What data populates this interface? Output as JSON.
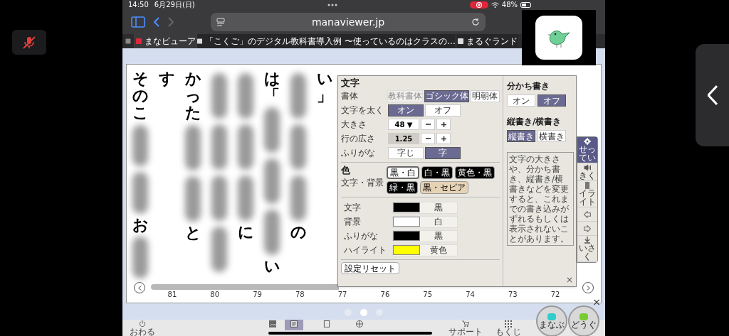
{
  "status_bar": {
    "time": "14:50",
    "date": "6月29日(日)",
    "battery": "48%",
    "recording": true
  },
  "browser": {
    "url": "manaviewer.jp",
    "tabs": [
      {
        "label": "まなビューア",
        "selected": true
      },
      {
        "label": "「こくご」のデジタル教科書導入例 〜使っているのはクラスの…",
        "selected": false
      },
      {
        "label": "まるぐランド",
        "selected": false
      }
    ]
  },
  "page": {
    "columns": [
      {
        "segments": [
          {
            "kind": "text",
            "text": "そのこ"
          },
          {
            "kind": "blur"
          },
          {
            "kind": "blur"
          },
          {
            "kind": "text",
            "text": "お"
          },
          {
            "kind": "blur"
          }
        ]
      },
      {
        "segments": [
          {
            "kind": "text",
            "text": "す"
          }
        ]
      },
      {
        "segments": [
          {
            "kind": "text",
            "text": "かった"
          },
          {
            "kind": "blur"
          },
          {
            "kind": "blur"
          },
          {
            "kind": "text",
            "text": "と"
          }
        ]
      },
      {
        "segments": [
          {
            "kind": "blur"
          },
          {
            "kind": "blur"
          },
          {
            "kind": "blur"
          },
          {
            "kind": "blur"
          }
        ]
      },
      {
        "segments": [
          {
            "kind": "blur"
          },
          {
            "kind": "blur"
          },
          {
            "kind": "blur"
          },
          {
            "kind": "text",
            "text": "に"
          }
        ]
      },
      {
        "segments": [
          {
            "kind": "text",
            "text": "は「"
          },
          {
            "kind": "blur"
          },
          {
            "kind": "blur"
          },
          {
            "kind": "blur"
          },
          {
            "kind": "text",
            "text": "い"
          }
        ]
      },
      {
        "segments": [
          {
            "kind": "blur"
          },
          {
            "kind": "blur"
          },
          {
            "kind": "blur"
          },
          {
            "kind": "text",
            "text": "の"
          }
        ]
      },
      {
        "segments": [
          {
            "kind": "text",
            "text": "い」"
          }
        ]
      }
    ],
    "page_numbers": [
      "81",
      "80",
      "79",
      "78",
      "77",
      "76",
      "75",
      "74",
      "73",
      "72"
    ],
    "dots": [
      {
        "selected": false
      },
      {
        "selected": true
      },
      {
        "selected": false
      }
    ]
  },
  "settings": {
    "moji": {
      "title": "文字",
      "rows": [
        {
          "label": "書体",
          "kind": "options",
          "options": [
            {
              "label": "教科書体",
              "selected": false,
              "disabled": true
            },
            {
              "label": "ゴシック体",
              "selected": true,
              "disabled": false
            },
            {
              "label": "明朝体",
              "selected": false,
              "disabled": false
            }
          ]
        },
        {
          "label": "文字を太く",
          "kind": "options",
          "options": [
            {
              "label": "オン",
              "selected": true,
              "disabled": false
            },
            {
              "label": "オフ",
              "selected": false,
              "disabled": false
            }
          ]
        },
        {
          "label": "大きさ",
          "kind": "dropdown",
          "value": "48 ▼"
        },
        {
          "label": "行の広さ",
          "kind": "stepper",
          "value": "1.25"
        },
        {
          "label": "ふりがな",
          "kind": "options",
          "options": [
            {
              "label": "字じ",
              "selected": false,
              "disabled": false
            },
            {
              "label": "字",
              "selected": true,
              "disabled": false
            }
          ]
        }
      ]
    },
    "iro": {
      "title": "色",
      "label": "文字・背景",
      "presets": [
        {
          "label": "黒・白",
          "color": "#ffffff",
          "selected": true
        },
        {
          "label": "白・黒",
          "color": "#000000",
          "selected": false
        },
        {
          "label": "黄色・黒",
          "color": "#000000",
          "selected": false
        },
        {
          "label": "緑・黒",
          "color": "#000000",
          "selected": false
        },
        {
          "label": "黒・セピア",
          "color": "#e6d3b5",
          "selected": false
        }
      ],
      "swatches": [
        {
          "label": "文字",
          "color": "#000000",
          "name": "黒"
        },
        {
          "label": "背景",
          "color": "#ffffff",
          "name": "白"
        },
        {
          "label": "ふりがな",
          "color": "#000000",
          "name": "黒"
        },
        {
          "label": "ハイライト",
          "color": "#ffff00",
          "name": "黄色"
        }
      ]
    },
    "reset": "設定リセット",
    "close": "×",
    "wakachi": {
      "title": "分かち書き",
      "options": [
        {
          "label": "オン",
          "selected": false
        },
        {
          "label": "オフ",
          "selected": true
        }
      ]
    },
    "direction": {
      "title": "縦書き/横書き",
      "options": [
        {
          "label": "縦書き",
          "selected": true
        },
        {
          "label": "横書き",
          "selected": false
        }
      ]
    },
    "note": "文字の大きさや、分かち書き、縦書き/横書きなどを変更すると、これまでの書き込みがずれるもしくは表示されないことがあります。"
  },
  "side_toolbar": [
    {
      "label": "せってい",
      "kind": "gear",
      "selected": true
    },
    {
      "label": "きく",
      "kind": "speaker",
      "selected": false
    },
    {
      "label": "イライト",
      "kind": "marker",
      "selected": false
    },
    {
      "kind": "left",
      "selected": false
    },
    {
      "kind": "right",
      "selected": false
    },
    {
      "label": "いさく",
      "kind": "download",
      "selected": false
    }
  ],
  "app_close": "×",
  "bottom_toolbar": {
    "items": [
      {
        "label": "おわる",
        "kind": "power",
        "selected": false
      },
      {
        "kind": "picture",
        "selected": false
      },
      {
        "kind": "book",
        "selected": true
      },
      {
        "kind": "sheet",
        "selected": false
      },
      {
        "kind": "globe",
        "selected": false
      },
      {
        "label": "サポート",
        "kind": "cart",
        "selected": false
      },
      {
        "label": "もくじ",
        "kind": "grid",
        "selected": false
      }
    ],
    "buttons": [
      {
        "label": "まなぶ",
        "color": "#33cccc"
      },
      {
        "label": "どうぐ",
        "color": "#77cc33"
      }
    ]
  }
}
